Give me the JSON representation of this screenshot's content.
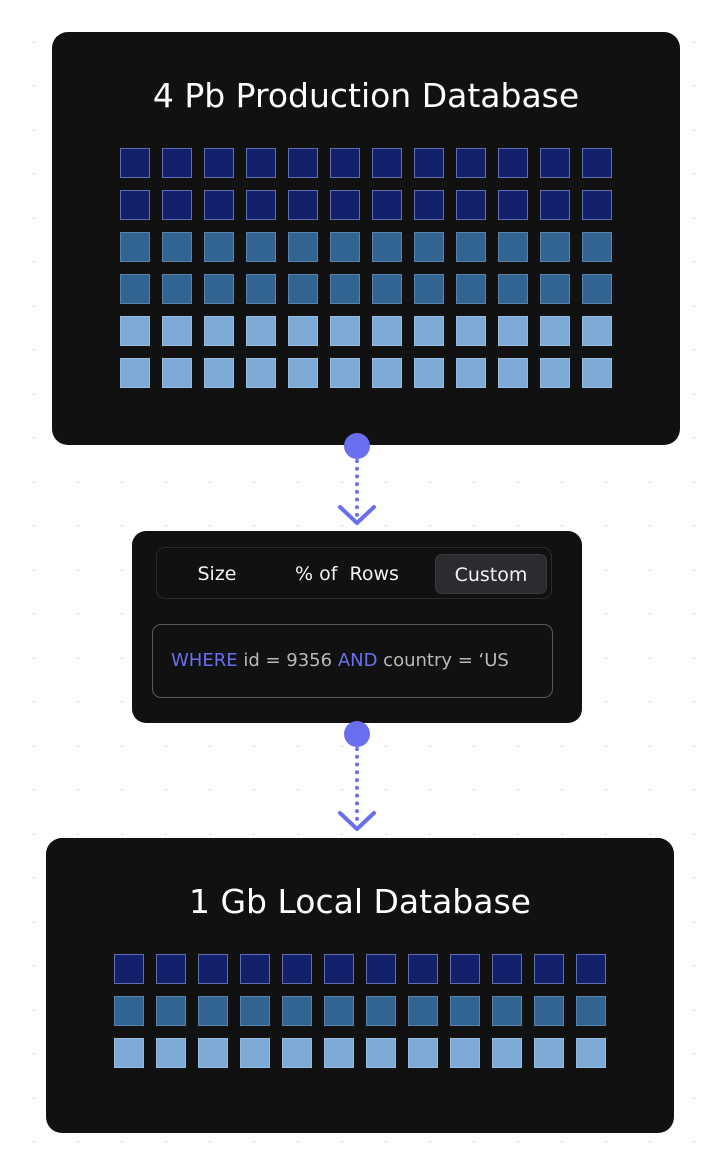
{
  "production_db": {
    "title": "4 Pb Production Database",
    "grid_rows": [
      "dark",
      "dark",
      "mid",
      "mid",
      "light",
      "light"
    ],
    "columns": 12
  },
  "filter": {
    "tabs": [
      {
        "label": "Size",
        "selected": false
      },
      {
        "label": "% of  Rows",
        "selected": false
      },
      {
        "label": "Custom",
        "selected": true
      }
    ],
    "query": {
      "keyword_where": "WHERE",
      "clause_1": " id = 9356 ",
      "keyword_and": "AND",
      "clause_2": " country = ‘US"
    }
  },
  "local_db": {
    "title": "1 Gb Local Database",
    "grid_rows": [
      "dark",
      "mid",
      "light"
    ],
    "columns": 12
  },
  "colors": {
    "accent": "#6a6ff0",
    "card_background": "#111111",
    "cell_dark": "#13206b",
    "cell_mid": "#336592",
    "cell_light": "#7dabd6"
  }
}
